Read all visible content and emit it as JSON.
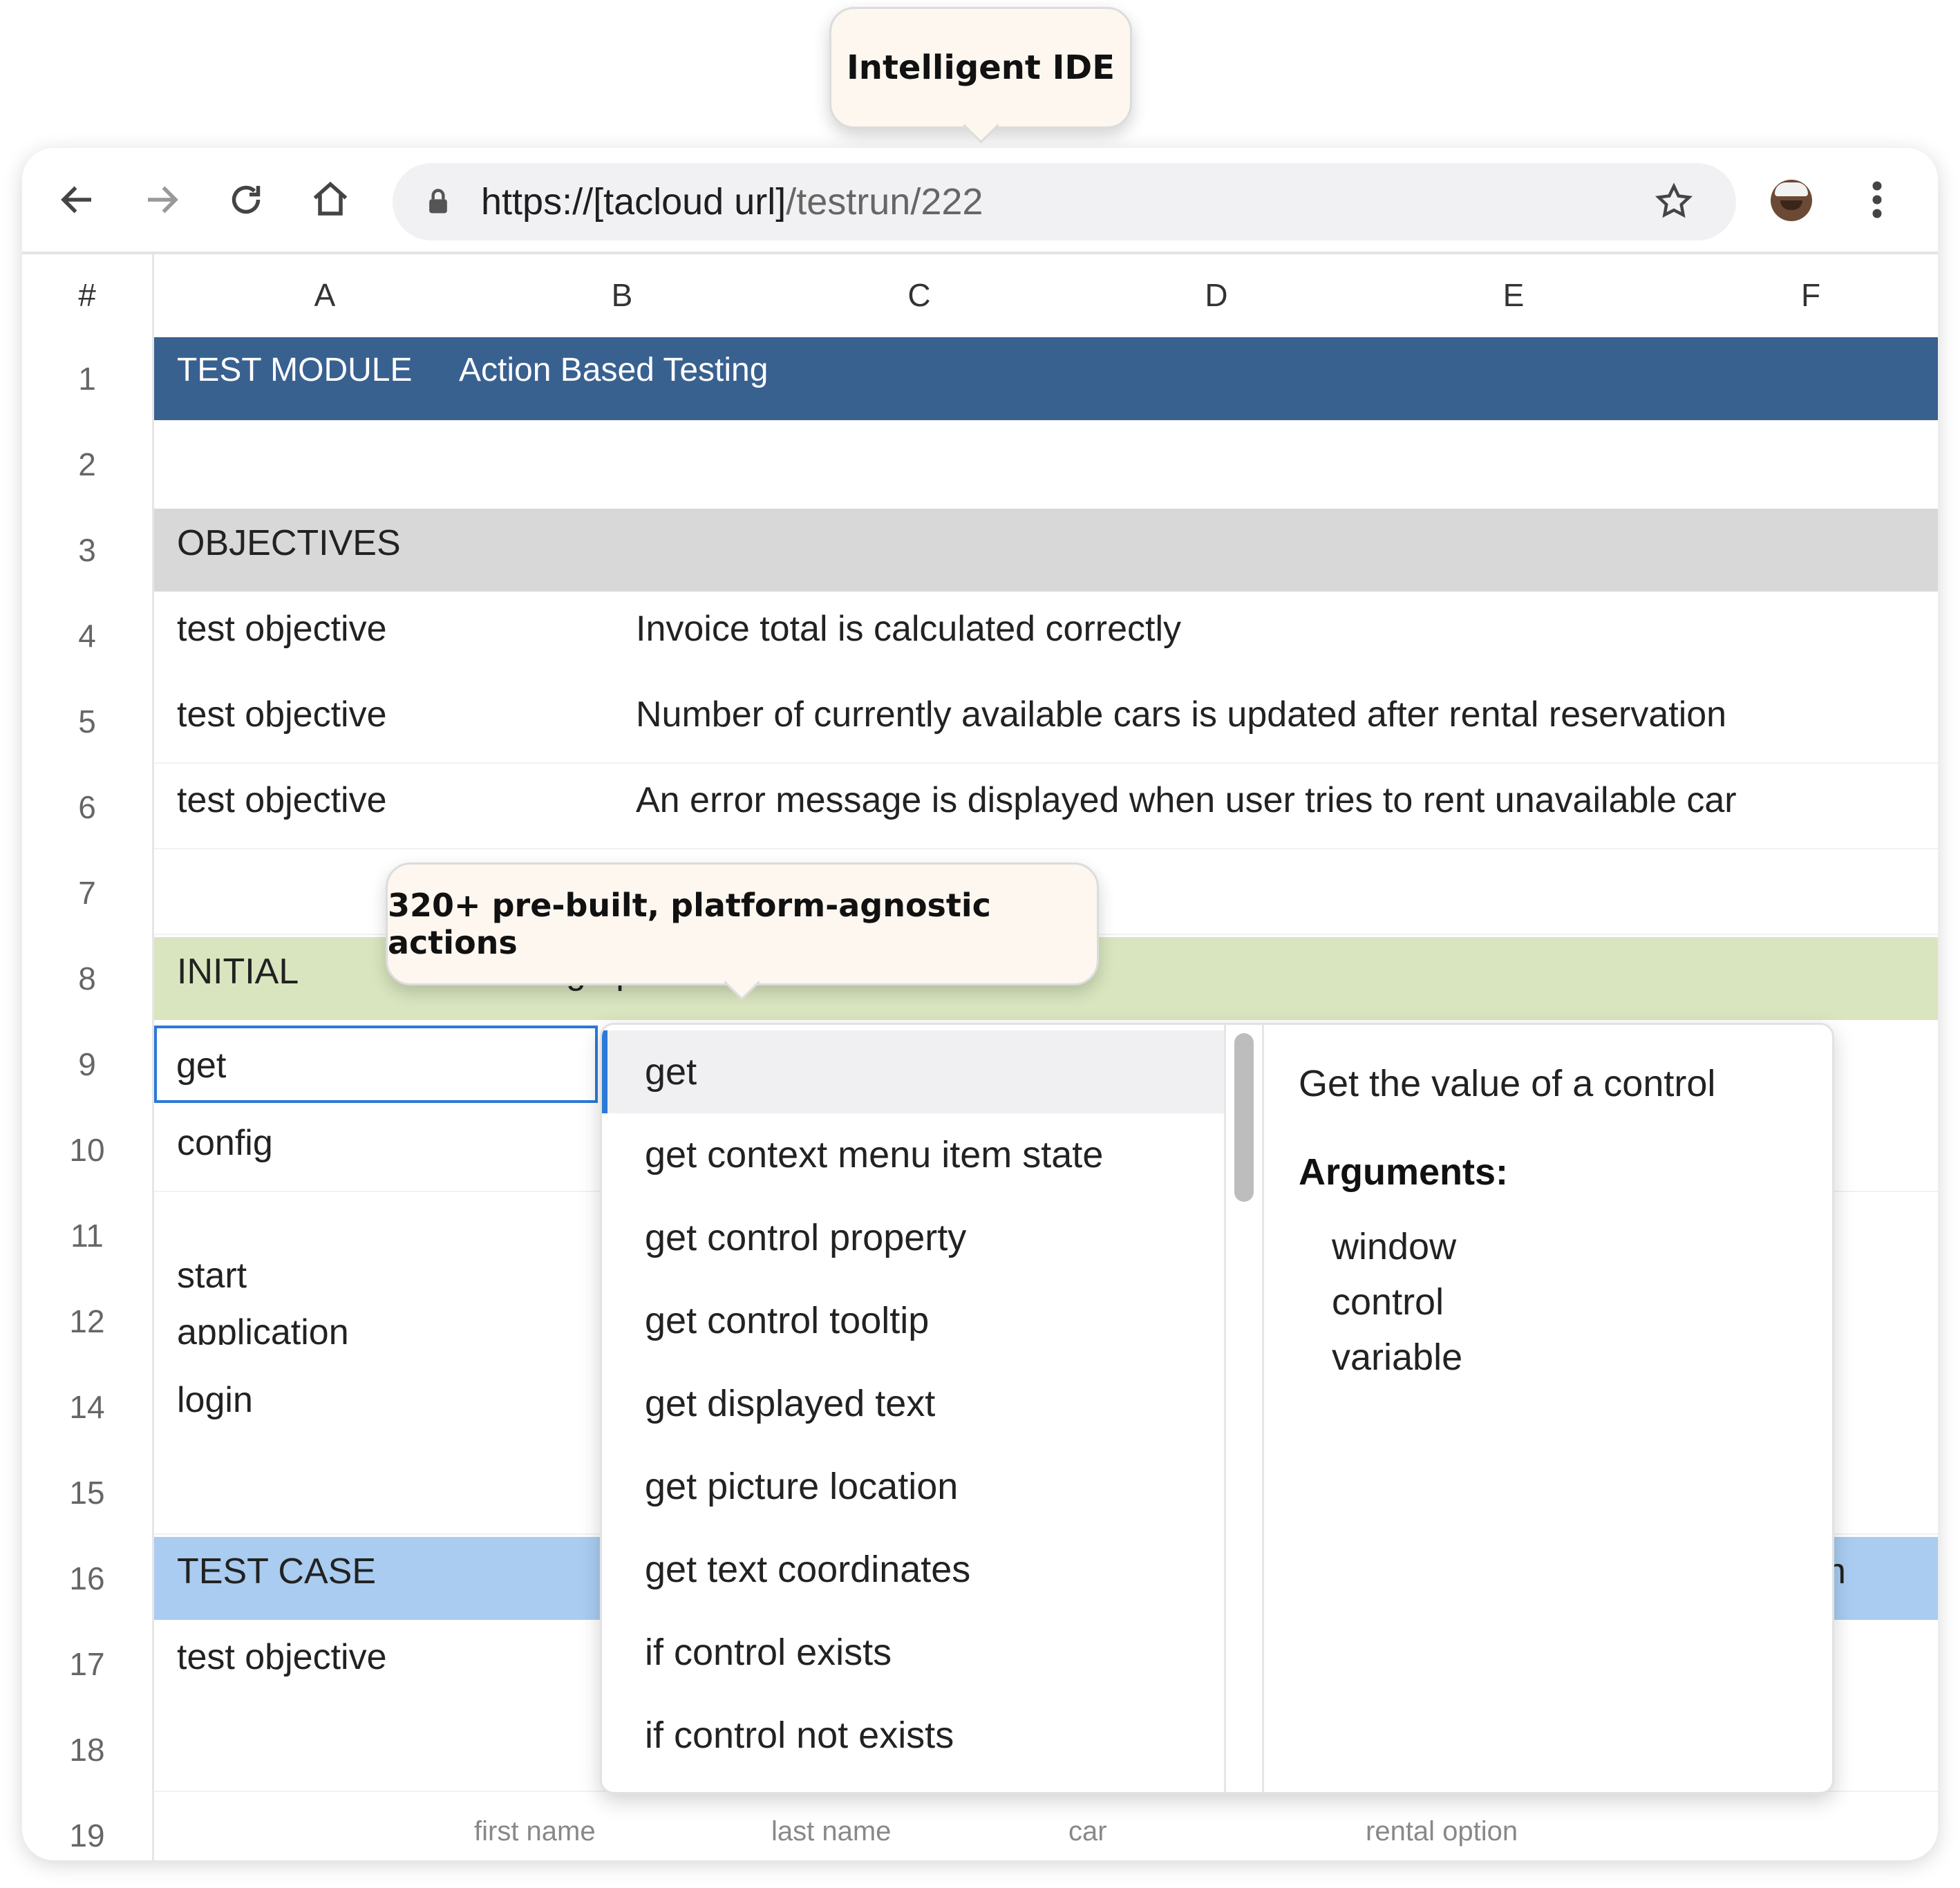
{
  "callouts": {
    "ide": "Intelligent IDE",
    "actions": "320+ pre-built, platform-agnostic actions"
  },
  "browser": {
    "url_host": "https://[tacloud url]",
    "url_path": "/testrun/222",
    "icons": [
      "back-icon",
      "forward-icon",
      "reload-icon",
      "home-icon",
      "lock-icon",
      "star-icon",
      "avatar",
      "menu-icon"
    ]
  },
  "sheet": {
    "corner": "#",
    "columns": [
      "A",
      "B",
      "C",
      "D",
      "E",
      "F"
    ],
    "row_numbers": [
      "1",
      "2",
      "3",
      "4",
      "5",
      "6",
      "7",
      "8",
      "9",
      "10",
      "11",
      "12",
      "14",
      "15",
      "16",
      "17",
      "18",
      "19"
    ],
    "row1": {
      "a": "TEST MODULE",
      "b": "Action Based Testing"
    },
    "row3": {
      "a": "OBJECTIVES"
    },
    "row4": {
      "a": "test objective",
      "b": "Invoice total is calculated correctly"
    },
    "row5": {
      "a": "test objective",
      "b": "Number of currently available cars is updated after rental reservation"
    },
    "row6": {
      "a": "test objective",
      "b": "An error message is displayed when user tries to rent unavailable car"
    },
    "row8": {
      "a": "INITIAL",
      "b": "Setting up"
    },
    "row9": {
      "a": "get"
    },
    "row10": {
      "a": "config"
    },
    "row12": {
      "a1": "start",
      "a2": "application"
    },
    "row14": {
      "a": "login"
    },
    "row16": {
      "a": "TEST CASE",
      "f": "n"
    },
    "row17": {
      "a": "test objective"
    },
    "row19": {
      "b": "first name",
      "c": "last name",
      "d": "car",
      "e": "rental option"
    }
  },
  "dropdown": {
    "items": [
      "get",
      "get context menu item state",
      "get control property",
      "get control tooltip",
      "get displayed text",
      "get picture location",
      "get text coordinates",
      "if control exists",
      "if control not exists"
    ],
    "selected_index": 0,
    "description": "Get the value of a control",
    "arguments_label": "Arguments:",
    "arguments": [
      "window",
      "control",
      "variable"
    ]
  },
  "colors": {
    "module_band": "#386190",
    "objectives_band": "#d8d8d8",
    "initial_band": "#d9e5bf",
    "testcase_band": "#a9ccf0",
    "selection_border": "#2b79d8"
  }
}
